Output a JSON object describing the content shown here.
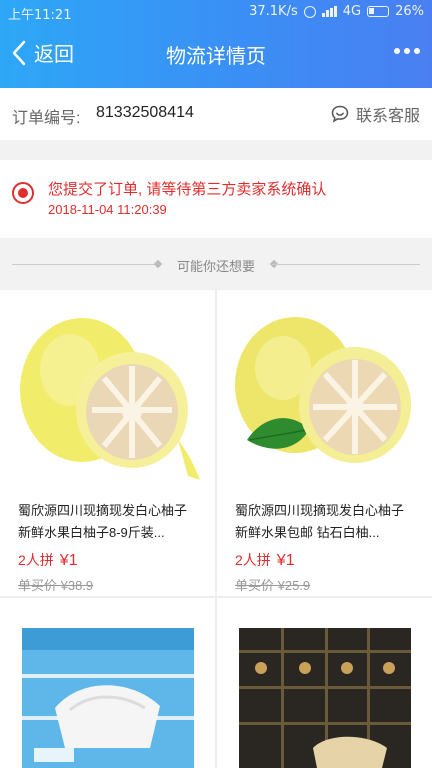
{
  "status_bar": {
    "time": "上午11:21",
    "speed": "37.1K/s",
    "network": "4G",
    "battery": "26%"
  },
  "nav": {
    "back_label": "返回",
    "title": "物流详情页"
  },
  "order": {
    "label": "订单编号:",
    "number": "81332508414",
    "service_label": "联系客服"
  },
  "notice": {
    "message": "您提交了订单, 请等待第三方卖家系统确认",
    "time": "2018-11-04 11:20:39"
  },
  "recommend": {
    "title": "可能你还想要"
  },
  "products": [
    {
      "name": "蜀欣源四川现摘现发白心柚子新鲜水果白柚子8-9斤装...",
      "group_label": "2人拼",
      "group_price": "¥1",
      "single_price": "单买价 ¥38.9"
    },
    {
      "name": "蜀欣源四川现摘现发白心柚子新鲜水果包邮 钻石白柚...",
      "group_label": "2人拼",
      "group_price": "¥1",
      "single_price": "单买价 ¥25.9"
    },
    {
      "name": "",
      "group_label": "",
      "group_price": "",
      "single_price": ""
    },
    {
      "name": "",
      "group_label": "",
      "group_price": "",
      "single_price": ""
    }
  ],
  "colors": {
    "header_start": "#2ea7f6",
    "header_end": "#4a7ff2",
    "accent_red": "#e02e2e"
  }
}
